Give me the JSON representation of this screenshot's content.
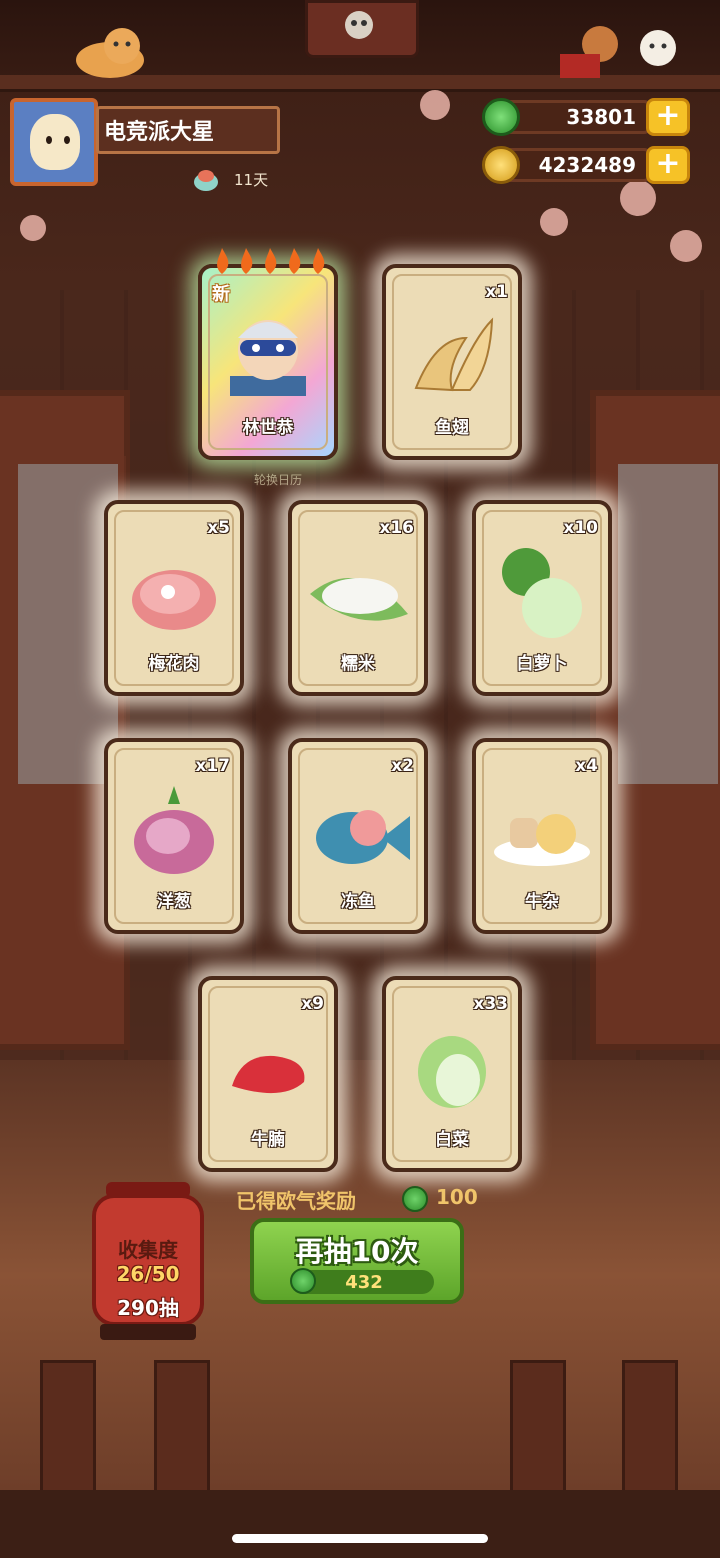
{
  "profile": {
    "name": "电竞派大星",
    "days": "11天"
  },
  "currency": {
    "jade": {
      "value": "33801",
      "icon": "jade-coin-icon"
    },
    "gold": {
      "value": "4232489",
      "icon": "gold-coin-icon"
    }
  },
  "cards": [
    {
      "label": "林世恭",
      "count": "",
      "new_tag": "新",
      "rarity_flames": 5
    },
    {
      "label": "鱼翅",
      "count": "x1"
    },
    {
      "label": "梅花肉",
      "count": "x5"
    },
    {
      "label": "糯米",
      "count": "x16"
    },
    {
      "label": "白萝卜",
      "count": "x10"
    },
    {
      "label": "洋葱",
      "count": "x17"
    },
    {
      "label": "冻鱼",
      "count": "x2"
    },
    {
      "label": "牛杂",
      "count": "x4"
    },
    {
      "label": "牛腩",
      "count": "x9"
    },
    {
      "label": "白菜",
      "count": "x33"
    }
  ],
  "background_text": "轮换日历",
  "collection": {
    "title": "收集度",
    "progress": "26/50",
    "draws": "290抽"
  },
  "reward": {
    "label": "已得欧气奖励",
    "value": "100"
  },
  "draw_button": {
    "label": "再抽10次",
    "cost": "432"
  },
  "colors": {
    "accent_green": "#5da52a",
    "plus_yellow": "#f6c227",
    "lantern_red": "#c23a2f"
  }
}
